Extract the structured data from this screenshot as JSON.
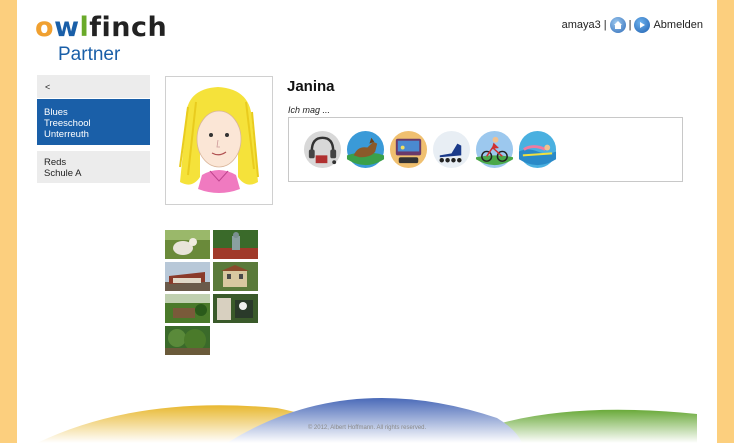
{
  "brand": {
    "letters": [
      "o",
      "w",
      "l",
      "f",
      "i",
      "n",
      "c",
      "h"
    ],
    "letter_colors": [
      "#f0a030",
      "#1a5fa8",
      "#6aaa2a",
      "#222222",
      "#222222",
      "#222222",
      "#222222",
      "#222222"
    ],
    "subtitle": "Partner"
  },
  "header": {
    "username": "amaya3",
    "separator": "|",
    "logout_label": "Abmelden"
  },
  "sidebar": {
    "back_label": "<",
    "items": [
      {
        "line1": "Blues",
        "line2": "Treeschool",
        "line3": "Unterreuth",
        "active": true
      },
      {
        "line1": "Reds",
        "line2": "Schule A",
        "active": false
      }
    ]
  },
  "profile": {
    "name": "Janina",
    "likes_label": "Ich mag ...",
    "likes": [
      "music-headphones-icon",
      "dog-icon",
      "video-game-icon",
      "inline-skates-icon",
      "cycling-icon",
      "swimming-icon"
    ]
  },
  "gallery": {
    "photos": [
      "cat-photo",
      "statue-photo",
      "house-photo",
      "building-photo",
      "garden-photo",
      "shed-photo",
      "bushes-photo"
    ]
  },
  "footer": {
    "copyright": "© 2012, Albert Hoffmann. All rights reserved."
  },
  "colors": {
    "frame": "#fccf7e",
    "accent": "#1a5fa8",
    "sidebar_bg": "#ececec"
  }
}
